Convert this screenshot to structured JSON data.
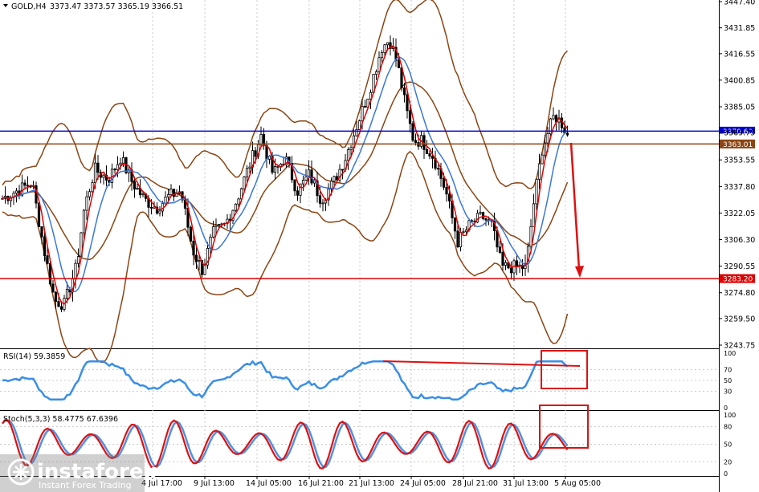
{
  "header": {
    "symbol": "GOLD,H4",
    "ohlc": "3373.47 3373.57 3365.19 3366.51",
    "rsi_label": "RSI(14) 59.3859",
    "stoch_label": "Stoch(5,3,3) 58.4775 67.6396"
  },
  "colors": {
    "candle": "#000000",
    "bollinger": "#8B4513",
    "ma_fast": "#e00000",
    "ma_slow": "#3a78d8",
    "level_blue": "#0000cc",
    "level_brown": "#8B4513",
    "level_red": "#dd0000",
    "rsi": "#3a8ee6",
    "stoch_main": "#dd1111",
    "stoch_signal": "#5590e0",
    "annotation": "#dd1111"
  },
  "chart_data": [
    {
      "type": "candlestick",
      "name": "price",
      "yticks": [
        "3447.40",
        "3431.85",
        "3416.55",
        "3400.85",
        "3385.05",
        "3369.75",
        "3353.55",
        "3337.80",
        "3322.05",
        "3306.30",
        "3290.55",
        "3274.80",
        "3259.50",
        "3243.75"
      ],
      "xticks": [
        "4 Jul 17:00",
        "9 Jul 13:00",
        "14 Jul 05:00",
        "16 Jul 21:00",
        "21 Jul 13:00",
        "24 Jul 05:00",
        "28 Jul 21:00",
        "31 Jul 13:00",
        "5 Aug 05:00"
      ],
      "ylim": [
        3243.75,
        3447.4
      ],
      "levels": [
        {
          "label": "3370.60",
          "value": 3370.6,
          "color": "blue"
        },
        {
          "label": "3366.51",
          "value": 3366.51,
          "color": "gray"
        },
        {
          "label": "3363.01",
          "value": 3363.01,
          "color": "brown"
        },
        {
          "label": "3283.20",
          "value": 3283.2,
          "color": "red"
        }
      ],
      "annotation": "down arrow projection to 3283.20"
    },
    {
      "type": "line",
      "name": "RSI(14)",
      "value": 59.3859,
      "yticks": [
        "100",
        "70",
        "50",
        "30",
        "0"
      ],
      "ylim": [
        0,
        100
      ],
      "annotations": [
        "bearish divergence trend line",
        "highlight box on latest values"
      ]
    },
    {
      "type": "line",
      "name": "Stoch(5,3,3)",
      "values": [
        58.4775,
        67.6396
      ],
      "yticks": [
        "100",
        "80",
        "50",
        "20",
        "0"
      ],
      "ylim": [
        0,
        100
      ],
      "annotations": [
        "highlight box on latest values"
      ]
    }
  ],
  "watermark": {
    "brand": "instaforex",
    "tagline": "Instant Forex Trading"
  }
}
